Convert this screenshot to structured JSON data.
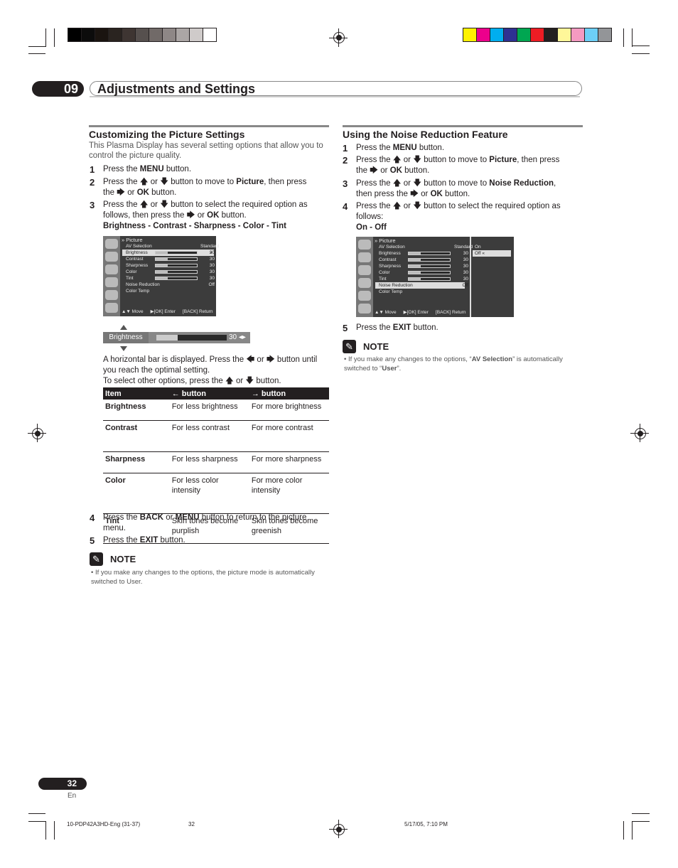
{
  "print_marks": {
    "gray_swatches": [
      "#000000",
      "#0c0c0c",
      "#1a1410",
      "#2a2420",
      "#3e3532",
      "#56504e",
      "#716a68",
      "#8e8786",
      "#aba6a5",
      "#cfcbca",
      "#ffffff"
    ],
    "color_swatches": [
      "#fff200",
      "#ec008c",
      "#00aeef",
      "#2e3192",
      "#00a651",
      "#ed1c24",
      "#231f20",
      "#fff799",
      "#f49ac1",
      "#6dcff6",
      "#939598"
    ],
    "footer_file": "10-PDP42A3HD-Eng (31-37)",
    "footer_page": "32",
    "footer_timestamp": "5/17/05, 7:10 PM"
  },
  "chapter": {
    "number": "09",
    "title": "Adjustments and Settings"
  },
  "left": {
    "heading": "Customizing the Picture Settings",
    "intro": "This Plasma Display has several setting options that allow you to control the picture quality.",
    "steps": [
      {
        "n": "1",
        "html": "Press the <b>MENU</b> button."
      },
      {
        "n": "2",
        "html": "Press the &#x1F845; or &#x1F847; button to move to <b>Picture</b>, then press the &#x1F846; or <b>OK</b> button."
      },
      {
        "n": "3",
        "html": "Press the &#x1F845; or &#x1F847; button to select the required option as follows, then press the &#x1F846; or <b>OK</b> button.<br><b>Brightness - Contrast - Sharpness - Color - Tint</b>"
      }
    ],
    "osd": {
      "title": "Picture",
      "rows": [
        {
          "label": "AV Selection",
          "value": "Standard"
        },
        {
          "label": "Brightness",
          "value": "30",
          "level": 0.3
        },
        {
          "label": "Contrast",
          "value": "30",
          "level": 0.3
        },
        {
          "label": "Sharpness",
          "value": "30",
          "level": 0.3
        },
        {
          "label": "Color",
          "value": "30",
          "level": 0.3
        },
        {
          "label": "Tint",
          "value": "30",
          "level": 0.3
        },
        {
          "label": "Noise Reduction",
          "value": "Off"
        },
        {
          "label": "Color Temp",
          "value": ""
        }
      ],
      "selected": "Brightness",
      "footer": {
        "move": "Move",
        "enter": "Enter",
        "return": "Return",
        "ok_key": "OK",
        "back_key": "BACK"
      }
    },
    "adjust_bar": {
      "label": "Brightness",
      "value": "30",
      "level": 0.3
    },
    "after_bar_text": "A horizontal bar is displayed. Press the &#x1F844; or &#x1F846; button until you reach the optimal setting.<br>To select other options, press the &#x1F845; or &#x1F847; button.",
    "table": {
      "headers": [
        "Item",
        "← button",
        "→ button"
      ],
      "rows": [
        [
          "Brightness",
          "For less brightness",
          "For more brightness"
        ],
        [
          "Contrast",
          "For less contrast",
          "For more contrast"
        ],
        [
          "Sharpness",
          "For less sharpness",
          "For more sharpness"
        ],
        [
          "Color",
          "For less color intensity",
          "For more color intensity"
        ],
        [
          "Tint",
          "Skin tones become purplish",
          "Skin tones become greenish"
        ]
      ]
    },
    "steps_after": [
      {
        "n": "4",
        "html": "Press the <b>BACK</b> or <b>MENU</b> button to return to the picture menu."
      },
      {
        "n": "5",
        "html": "Press the <b>EXIT</b> button."
      }
    ],
    "note_title": "NOTE",
    "note_text": "If you make any changes to the options, the picture mode is automatically switched to User."
  },
  "right": {
    "heading": "Using the Noise Reduction Feature",
    "steps": [
      {
        "n": "1",
        "html": "Press the <b>MENU</b> button."
      },
      {
        "n": "2",
        "html": "Press the &#x1F845; or &#x1F847; button to move to <b>Picture</b>, then press the &#x1F846; or <b>OK</b> button."
      },
      {
        "n": "3",
        "html": "Press the &#x1F845; or &#x1F847; button to move to <b>Noise Reduction</b>, then press the &#x1F846; or <b>OK</b> button."
      },
      {
        "n": "4",
        "html": "Press the &#x1F845; or &#x1F847; button to select the required option as follows:<br><b>On - Off</b>"
      }
    ],
    "osd": {
      "title": "Picture",
      "rows": [
        {
          "label": "AV Selection",
          "value": "Standard"
        },
        {
          "label": "Brightness",
          "value": "30",
          "level": 0.3
        },
        {
          "label": "Contrast",
          "value": "30",
          "level": 0.3
        },
        {
          "label": "Sharpness",
          "value": "30",
          "level": 0.3
        },
        {
          "label": "Color",
          "value": "30",
          "level": 0.3
        },
        {
          "label": "Tint",
          "value": "30",
          "level": 0.3
        },
        {
          "label": "Noise Reduction",
          "value": "Off"
        },
        {
          "label": "Color Temp",
          "value": ""
        }
      ],
      "selected": "Noise Reduction",
      "options": [
        "On",
        "Off"
      ],
      "selected_option": "Off",
      "footer": {
        "move": "Move",
        "enter": "Enter",
        "return": "Return",
        "ok_key": "OK",
        "back_key": "BACK"
      }
    },
    "steps_after": [
      {
        "n": "5",
        "html": "Press the <b>EXIT</b> button."
      }
    ],
    "note_title": "NOTE",
    "note_html": "If you make any changes to the options, “<b>AV Selection</b>” is automatically switched to “<b>User</b>”."
  },
  "page": {
    "number": "32",
    "lang": "En"
  }
}
